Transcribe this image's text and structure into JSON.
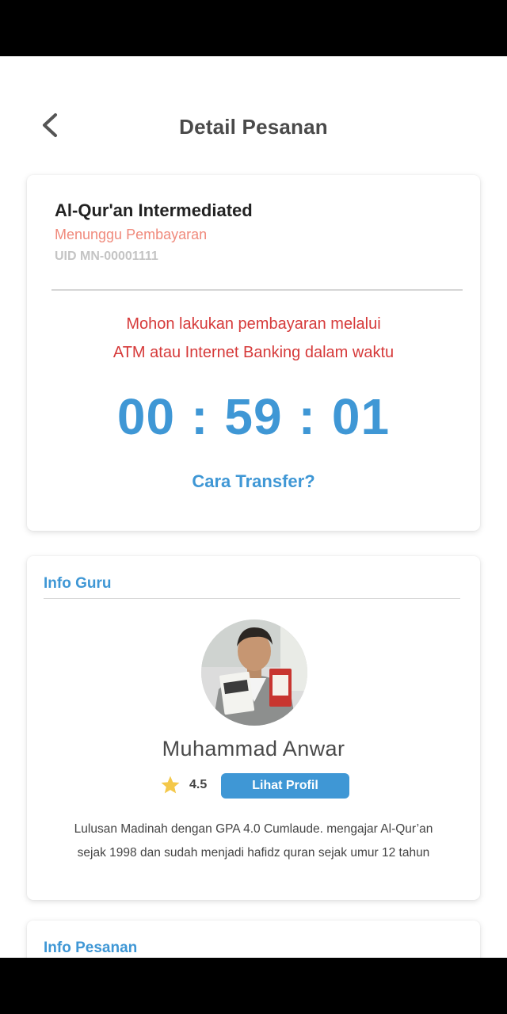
{
  "header": {
    "title": "Detail Pesanan"
  },
  "order": {
    "course_title": "Al-Qur'an Intermediated",
    "status": "Menunggu Pembayaran",
    "uid": "UID MN-00001111",
    "instruction_line1": "Mohon lakukan pembayaran melalui",
    "instruction_line2": "ATM atau Internet Banking dalam waktu",
    "countdown": {
      "hours": "00",
      "minutes": "59",
      "seconds": "01",
      "separator": ":"
    },
    "transfer_link": "Cara Transfer?"
  },
  "teacher_section": {
    "title": "Info Guru",
    "name": "Muhammad Anwar",
    "rating": "4.5",
    "profile_button": "Lihat Profil",
    "bio_line1": "Lulusan Madinah dengan GPA 4.0 Cumlaude. mengajar Al-Qur’an",
    "bio_line2": "sejak 1998 dan sudah menjadi hafidz quran sejak umur 12 tahun"
  },
  "order_section": {
    "title": "Info Pesanan"
  },
  "colors": {
    "accent": "#3f97d5",
    "status": "#f08a7c",
    "warning": "#d63a3a"
  },
  "icons": {
    "back": "chevron-left-icon",
    "star": "star-icon"
  }
}
